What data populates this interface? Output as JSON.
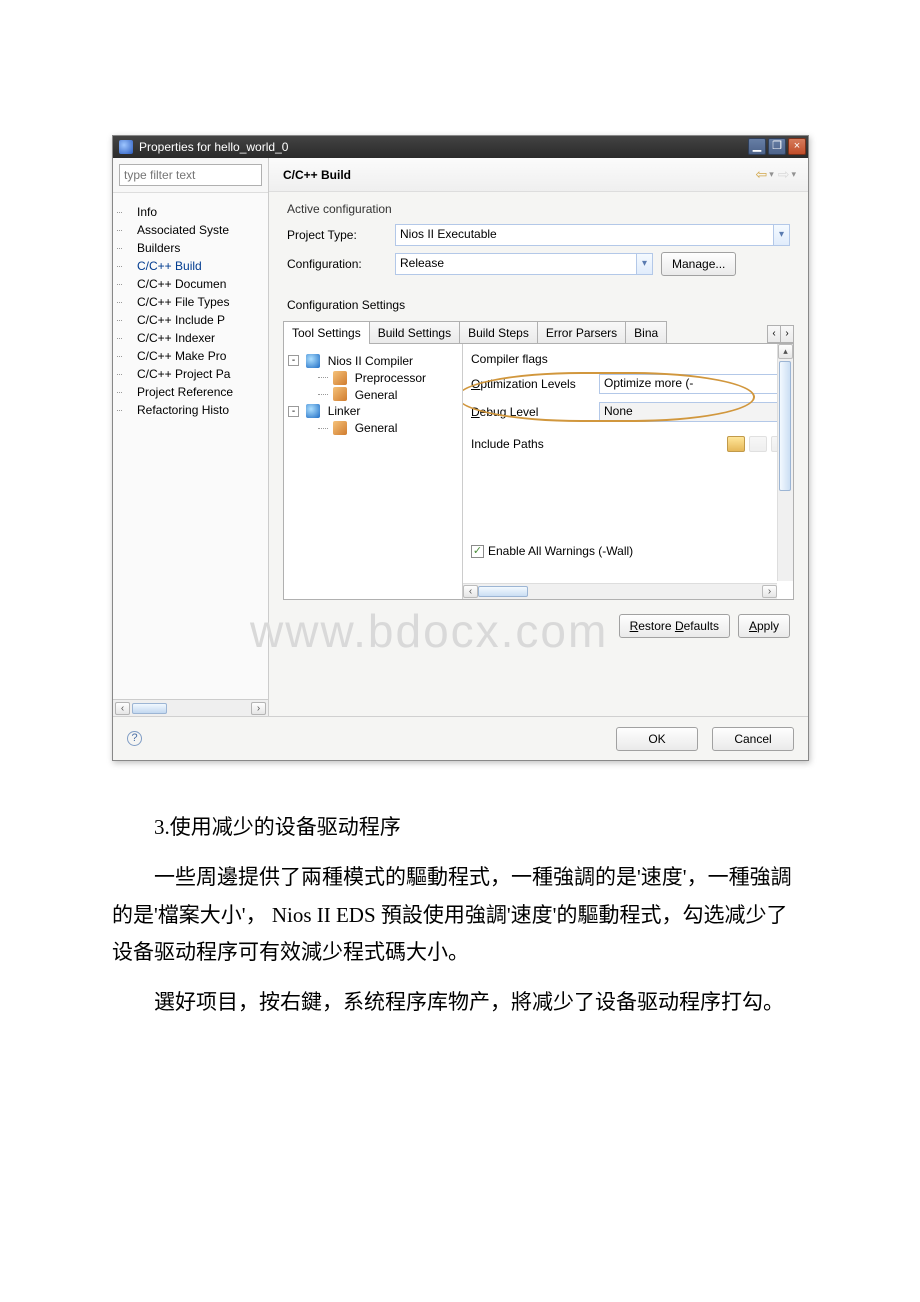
{
  "window": {
    "title": "Properties for hello_world_0",
    "minimize": "▁",
    "restore": "❐",
    "close": "×"
  },
  "filter_placeholder": "type filter text",
  "nav_items": [
    "Info",
    "Associated Syste",
    "Builders",
    "C/C++ Build",
    "C/C++ Documen",
    "C/C++ File Types",
    "C/C++ Include P",
    "C/C++ Indexer",
    "C/C++ Make Pro",
    "C/C++ Project Pa",
    "Project Reference",
    "Refactoring Histo"
  ],
  "nav_active_index": 3,
  "pane_title": "C/C++ Build",
  "active_config": {
    "legend": "Active configuration",
    "project_type_label": "Project Type:",
    "project_type_value": "Nios II Executable",
    "config_label": "Configuration:",
    "config_value": "Release",
    "manage_btn": "Manage..."
  },
  "settings_label": "Configuration Settings",
  "tabs": [
    "Tool Settings",
    "Build Settings",
    "Build Steps",
    "Error Parsers",
    "Bina"
  ],
  "tabs_active": 0,
  "tool_tree": {
    "compiler": "Nios II Compiler",
    "preprocessor": "Preprocessor",
    "general1": "General",
    "linker": "Linker",
    "general2": "General"
  },
  "props": {
    "flags_label": "Compiler flags",
    "opt_label": "Optimization Levels",
    "opt_value": "Optimize more (-",
    "debug_label": "Debug Level",
    "debug_value": "None",
    "include_label": "Include Paths",
    "warn_label": "Enable All Warnings (-Wall)"
  },
  "pane_buttons": {
    "restore": "Restore Defaults",
    "apply": "Apply"
  },
  "footer": {
    "ok": "OK",
    "cancel": "Cancel"
  },
  "watermark": "www.bdocx.com",
  "essay": {
    "p1": "3.使用减少的设备驱动程序",
    "p2": "一些周邊提供了兩種模式的驅動程式，一種強調的是'速度'，一種強調的是'檔案大小'， Nios II EDS 預設使用強調'速度'的驅動程式，勾选减少了设备驱动程序可有效減少程式碼大小。",
    "p3": "選好项目，按右鍵，系统程序库物产，將减少了设备驱动程序打勾。"
  }
}
